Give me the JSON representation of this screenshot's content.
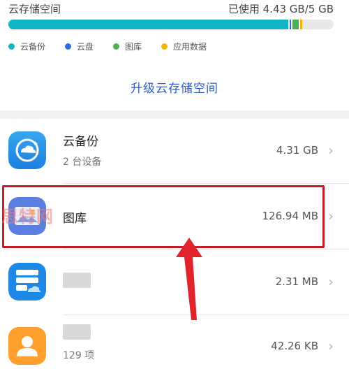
{
  "header": {
    "title": "云存储空间",
    "usage_text": "已使用 4.43 GB/5 GB"
  },
  "storage": {
    "used_fraction": 0.886,
    "segments": [
      {
        "name": "云备份",
        "fraction": 0.86,
        "color": "#12b5c4"
      },
      {
        "name": "云盘",
        "fraction": 0.004,
        "color": "#2b6cde"
      },
      {
        "name": "图库",
        "fraction": 0.02,
        "color": "#4caf50"
      },
      {
        "name": "应用数据",
        "fraction": 0.006,
        "color": "#f5b400"
      }
    ]
  },
  "legend": [
    {
      "label": "云备份",
      "color": "#12b5c4"
    },
    {
      "label": "云盘",
      "color": "#2b6cde"
    },
    {
      "label": "图库",
      "color": "#4caf50"
    },
    {
      "label": "应用数据",
      "color": "#f5b400"
    }
  ],
  "upgrade_label": "升级云存储空间",
  "items": [
    {
      "name": "云备份",
      "sub": "2 台设备",
      "size": "4.31 GB",
      "icon": "cloud-backup-icon"
    },
    {
      "name": "图库",
      "size": "126.94 MB",
      "icon": "gallery-icon"
    },
    {
      "size": "2.31 MB",
      "icon": "cloud-drive-icon"
    },
    {
      "sub": "129 项",
      "size": "42.26 KB",
      "icon": "contacts-icon"
    }
  ],
  "watermark_text": "思特网",
  "colors": {
    "accent": "#2e5ec7",
    "highlight": "#c41c25",
    "arrow": "#e0242c"
  }
}
